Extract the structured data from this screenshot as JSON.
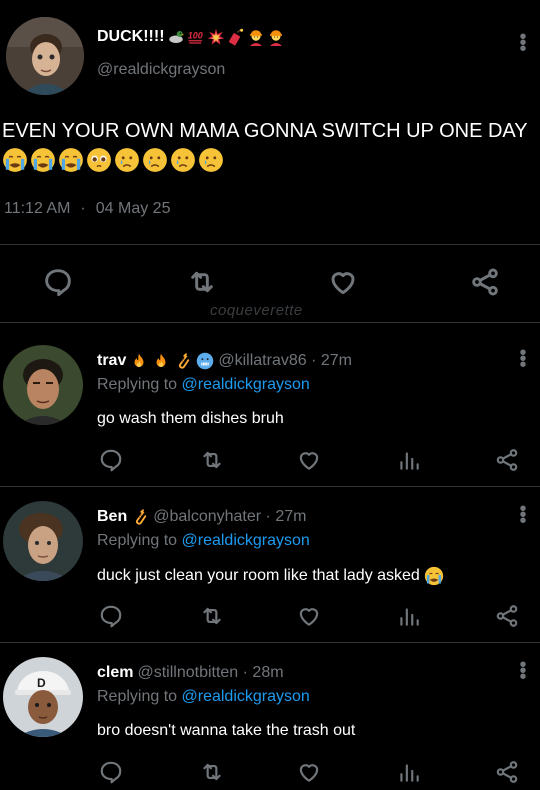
{
  "main_tweet": {
    "display_name": "DUCK!!!!",
    "name_emojis": [
      "duck-emoji",
      "hundred-emoji",
      "collision-emoji",
      "firecracker-emoji",
      "construction-worker-emoji",
      "construction-worker-emoji"
    ],
    "handle": "@realdickgrayson",
    "text": "EVEN YOUR OWN MAMA GONNA SWITCH UP ONE DAY",
    "text_emojis": [
      "loudly-crying-emoji",
      "loudly-crying-emoji",
      "loudly-crying-emoji",
      "pleading-emoji",
      "crying-emoji",
      "crying-emoji",
      "crying-emoji",
      "crying-emoji"
    ],
    "time": "11:12 AM",
    "separator": "·",
    "date": "04 May 25"
  },
  "watermark": "coqueverette",
  "replies": [
    {
      "name": "trav",
      "name_emojis": [
        "fire-emoji",
        "fire-emoji",
        "saxophone-emoji",
        "cold-face-emoji"
      ],
      "handle": "@killatrav86 · 27m",
      "replying_prefix": "Replying to",
      "replying_handle": "@realdickgrayson",
      "text": "go wash them dishes bruh",
      "text_emoji": ""
    },
    {
      "name": "Ben",
      "name_emojis": [
        "saxophone-emoji"
      ],
      "handle": "@balconyhater · 27m",
      "replying_prefix": "Replying to",
      "replying_handle": "@realdickgrayson",
      "text": "duck just clean your room like that lady asked",
      "text_emoji": "loudly-crying-emoji"
    },
    {
      "name": "clem",
      "name_emojis": [],
      "handle": "@stillnotbitten · 28m",
      "replying_prefix": "Replying to",
      "replying_handle": "@realdickgrayson",
      "text": "bro doesn't wanna take the trash out",
      "text_emoji": ""
    }
  ],
  "colors": {
    "background": "#000000",
    "text": "#e7e9ea",
    "secondary": "#71767b",
    "link": "#1d9bf0",
    "divider": "#2f3336"
  }
}
